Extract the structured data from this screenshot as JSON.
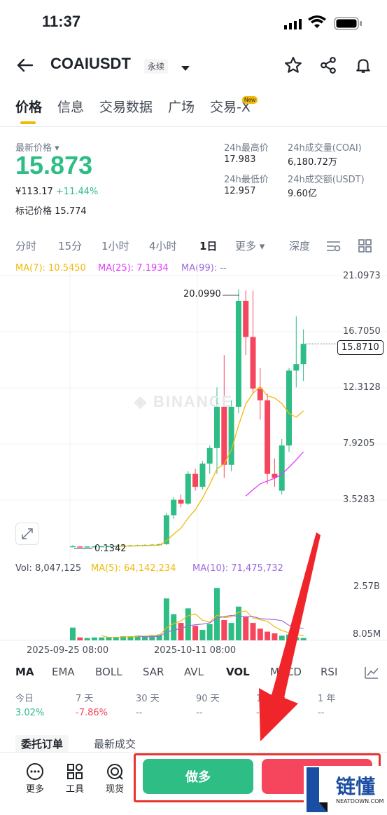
{
  "status_bar": {
    "time": "11:37"
  },
  "header": {
    "symbol": "COAIUSDT",
    "contract_type": "永续"
  },
  "tabs": [
    {
      "label": "价格",
      "active": true
    },
    {
      "label": "信息"
    },
    {
      "label": "交易数据"
    },
    {
      "label": "广场"
    },
    {
      "label": "交易-X",
      "badge": "New"
    }
  ],
  "ticker": {
    "last_price_label": "最新价格",
    "last_price": "15.873",
    "cny_price": "¥113.17",
    "change_pct": "+11.44%",
    "mark_price_label": "标记价格",
    "mark_price": "15.774",
    "high_label": "24h最高价",
    "high": "17.983",
    "low_label": "24h最低价",
    "low": "12.957",
    "vol_coin_label": "24h成交量(COAI)",
    "vol_coin": "6,180.72万",
    "vol_usdt_label": "24h成交额(USDT)",
    "vol_usdt": "9.60亿"
  },
  "intervals": [
    "分时",
    "15分",
    "1小时",
    "4小时",
    "1日",
    "更多",
    "深度"
  ],
  "active_interval": "1日",
  "ma_legend": {
    "ma7": "MA(7): 10.5450",
    "ma25": "MA(25): 7.1934",
    "ma99": "MA(99): --"
  },
  "price_axis": [
    "21.0973",
    "16.7050",
    "12.3128",
    "7.9205",
    "3.5283"
  ],
  "current_price_tag": "15.8710",
  "annotations": {
    "high": "20.0990",
    "low": "0.1342"
  },
  "watermark": "BINANCE",
  "volume_legend": {
    "vol": "Vol: 8,047,125",
    "ma5": "MA(5): 64,142,234",
    "ma10": "MA(10): 71,475,732"
  },
  "volume_axis": [
    "2.57B",
    "8.05M"
  ],
  "date_labels": [
    "2025-09-25 08:00",
    "2025-10-11 08:00"
  ],
  "indicators": [
    "MA",
    "EMA",
    "BOLL",
    "SAR",
    "AVL",
    "VOL",
    "MACD",
    "RSI"
  ],
  "active_indicator": "VOL",
  "performance": [
    {
      "label": "今日",
      "value": "3.02%",
      "color": "green"
    },
    {
      "label": "7 天",
      "value": "-7.86%",
      "color": "red"
    },
    {
      "label": "30 天",
      "value": "--",
      "color": "gray"
    },
    {
      "label": "90 天",
      "value": "--",
      "color": "gray"
    },
    {
      "label": "180 天",
      "value": "--",
      "color": "gray"
    },
    {
      "label": "1 年",
      "value": "--",
      "color": "gray"
    }
  ],
  "order_tabs": [
    "委托订单",
    "最新成交"
  ],
  "bottom_tools": [
    {
      "label": "更多",
      "icon": "more-icon"
    },
    {
      "label": "工具",
      "icon": "tools-icon"
    },
    {
      "label": "现货",
      "icon": "spot-icon"
    }
  ],
  "buttons": {
    "long": "做多",
    "short": "做空"
  },
  "logo": {
    "text": "链懂",
    "site": "NEATDOWN.COM"
  },
  "colors": {
    "up": "#2ebd85",
    "down": "#f6465d",
    "ma7": "#f0b90b",
    "ma25": "#e040fb",
    "ma99": "#9c6ade",
    "accent": "#f0b90b"
  },
  "chart_data": {
    "type": "candlestick",
    "ylim": [
      0.1342,
      21.0973
    ],
    "candles": [
      {
        "o": 0.14,
        "h": 0.3,
        "l": 0.13,
        "c": 0.2
      },
      {
        "o": 0.18,
        "h": 0.22,
        "l": 0.13,
        "c": 0.16
      },
      {
        "o": 0.16,
        "h": 0.2,
        "l": 0.14,
        "c": 0.18
      },
      {
        "o": 0.18,
        "h": 0.22,
        "l": 0.15,
        "c": 0.19
      },
      {
        "o": 0.19,
        "h": 0.23,
        "l": 0.16,
        "c": 0.2
      },
      {
        "o": 0.2,
        "h": 0.25,
        "l": 0.17,
        "c": 0.21
      },
      {
        "o": 0.21,
        "h": 0.26,
        "l": 0.18,
        "c": 0.22
      },
      {
        "o": 0.22,
        "h": 0.28,
        "l": 0.18,
        "c": 0.24
      },
      {
        "o": 0.24,
        "h": 0.3,
        "l": 0.2,
        "c": 0.26
      },
      {
        "o": 0.26,
        "h": 0.32,
        "l": 0.22,
        "c": 0.28
      },
      {
        "o": 0.28,
        "h": 0.34,
        "l": 0.24,
        "c": 0.3
      },
      {
        "o": 0.3,
        "h": 0.36,
        "l": 0.26,
        "c": 0.32
      },
      {
        "o": 0.32,
        "h": 0.4,
        "l": 0.28,
        "c": 0.36
      },
      {
        "o": 0.36,
        "h": 2.8,
        "l": 0.3,
        "c": 2.6
      },
      {
        "o": 2.6,
        "h": 4.0,
        "l": 2.3,
        "c": 3.8
      },
      {
        "o": 3.8,
        "h": 4.2,
        "l": 3.2,
        "c": 3.5
      },
      {
        "o": 3.5,
        "h": 6.0,
        "l": 3.4,
        "c": 5.8
      },
      {
        "o": 5.8,
        "h": 6.2,
        "l": 4.5,
        "c": 4.8
      },
      {
        "o": 4.8,
        "h": 6.8,
        "l": 4.6,
        "c": 6.6
      },
      {
        "o": 6.6,
        "h": 8.0,
        "l": 5.8,
        "c": 7.8
      },
      {
        "o": 7.8,
        "h": 12.5,
        "l": 5.8,
        "c": 11.0
      },
      {
        "o": 11.0,
        "h": 15.0,
        "l": 5.5,
        "c": 6.5
      },
      {
        "o": 6.5,
        "h": 11.5,
        "l": 6.0,
        "c": 11.0
      },
      {
        "o": 11.0,
        "h": 20.1,
        "l": 10.5,
        "c": 19.2
      },
      {
        "o": 19.2,
        "h": 20.0,
        "l": 15.0,
        "c": 16.4
      },
      {
        "o": 16.4,
        "h": 20.0,
        "l": 12.0,
        "c": 12.4
      },
      {
        "o": 12.4,
        "h": 14.0,
        "l": 10.0,
        "c": 11.5
      },
      {
        "o": 11.5,
        "h": 12.0,
        "l": 5.0,
        "c": 5.8
      },
      {
        "o": 5.8,
        "h": 7.0,
        "l": 4.8,
        "c": 5.5
      },
      {
        "o": 4.5,
        "h": 8.5,
        "l": 4.2,
        "c": 8.0
      },
      {
        "o": 8.0,
        "h": 14.0,
        "l": 7.5,
        "c": 13.8
      },
      {
        "o": 13.8,
        "h": 18.0,
        "l": 12.5,
        "c": 14.3
      },
      {
        "o": 14.3,
        "h": 17.0,
        "l": 13.0,
        "c": 15.87
      }
    ]
  }
}
